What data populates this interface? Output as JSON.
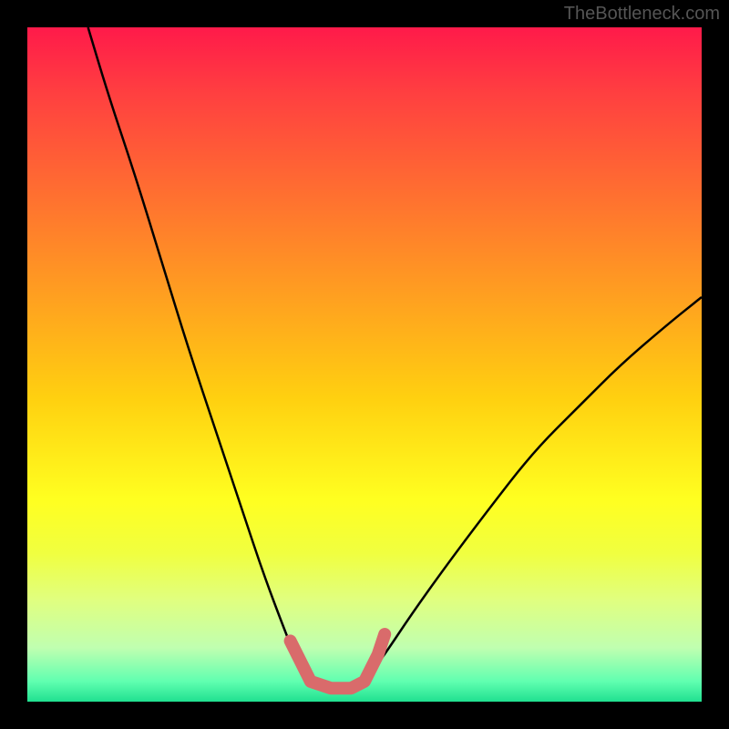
{
  "watermark": "TheBottleneck.com",
  "chart_data": {
    "type": "line",
    "title": "",
    "xlabel": "",
    "ylabel": "",
    "xlim": [
      0,
      100
    ],
    "ylim": [
      0,
      100
    ],
    "description": "Bottleneck curve: black V-shaped curve over red-to-green vertical gradient with a pink flat region at the trough.",
    "gradient_stops": [
      {
        "pos": 0.0,
        "color": "#ff1a4a"
      },
      {
        "pos": 0.25,
        "color": "#ff7030"
      },
      {
        "pos": 0.55,
        "color": "#ffd010"
      },
      {
        "pos": 0.78,
        "color": "#f0ff40"
      },
      {
        "pos": 0.97,
        "color": "#60ffb0"
      },
      {
        "pos": 1.0,
        "color": "#20e090"
      }
    ],
    "series": [
      {
        "name": "left-branch",
        "color": "#000000",
        "points": [
          {
            "x": 9,
            "y": 100
          },
          {
            "x": 12,
            "y": 90
          },
          {
            "x": 16,
            "y": 78
          },
          {
            "x": 20,
            "y": 65
          },
          {
            "x": 24,
            "y": 52
          },
          {
            "x": 28,
            "y": 40
          },
          {
            "x": 32,
            "y": 28
          },
          {
            "x": 35,
            "y": 19
          },
          {
            "x": 38,
            "y": 11
          },
          {
            "x": 40,
            "y": 6
          },
          {
            "x": 42,
            "y": 3
          }
        ]
      },
      {
        "name": "right-branch",
        "color": "#000000",
        "points": [
          {
            "x": 50,
            "y": 3
          },
          {
            "x": 53,
            "y": 7
          },
          {
            "x": 57,
            "y": 13
          },
          {
            "x": 62,
            "y": 20
          },
          {
            "x": 68,
            "y": 28
          },
          {
            "x": 75,
            "y": 37
          },
          {
            "x": 82,
            "y": 44
          },
          {
            "x": 88,
            "y": 50
          },
          {
            "x": 95,
            "y": 56
          },
          {
            "x": 100,
            "y": 60
          }
        ]
      },
      {
        "name": "pink-trough",
        "color": "#d96b6b",
        "points": [
          {
            "x": 39,
            "y": 9
          },
          {
            "x": 42,
            "y": 3
          },
          {
            "x": 45,
            "y": 2
          },
          {
            "x": 48,
            "y": 2
          },
          {
            "x": 50,
            "y": 3
          },
          {
            "x": 52,
            "y": 7
          },
          {
            "x": 53,
            "y": 10
          }
        ]
      }
    ]
  }
}
